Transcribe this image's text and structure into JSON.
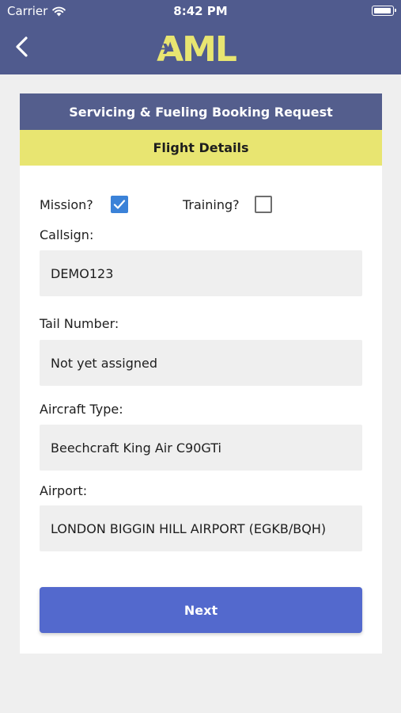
{
  "status_bar": {
    "carrier": "Carrier",
    "time": "8:42 PM"
  },
  "header": {
    "logo_text": "AML"
  },
  "card": {
    "title": "Servicing & Fueling Booking Request",
    "section": "Flight Details"
  },
  "form": {
    "mission": {
      "label": "Mission?",
      "checked": true
    },
    "training": {
      "label": "Training?",
      "checked": false
    },
    "callsign": {
      "label": "Callsign:",
      "value": "DEMO123"
    },
    "tail_number": {
      "label": "Tail Number:",
      "value": "Not yet assigned"
    },
    "aircraft_type": {
      "label": "Aircraft Type:",
      "value": "Beechcraft King Air C90GTi"
    },
    "airport": {
      "label": "Airport:",
      "value": "LONDON BIGGIN HILL AIRPORT (EGKB/BQH)"
    }
  },
  "next_button": {
    "label": "Next"
  },
  "colors": {
    "header_bg": "#505b8e",
    "brand_yellow": "#e8e571",
    "checkbox_blue": "#3b82d8",
    "button_blue": "#5369cd"
  }
}
